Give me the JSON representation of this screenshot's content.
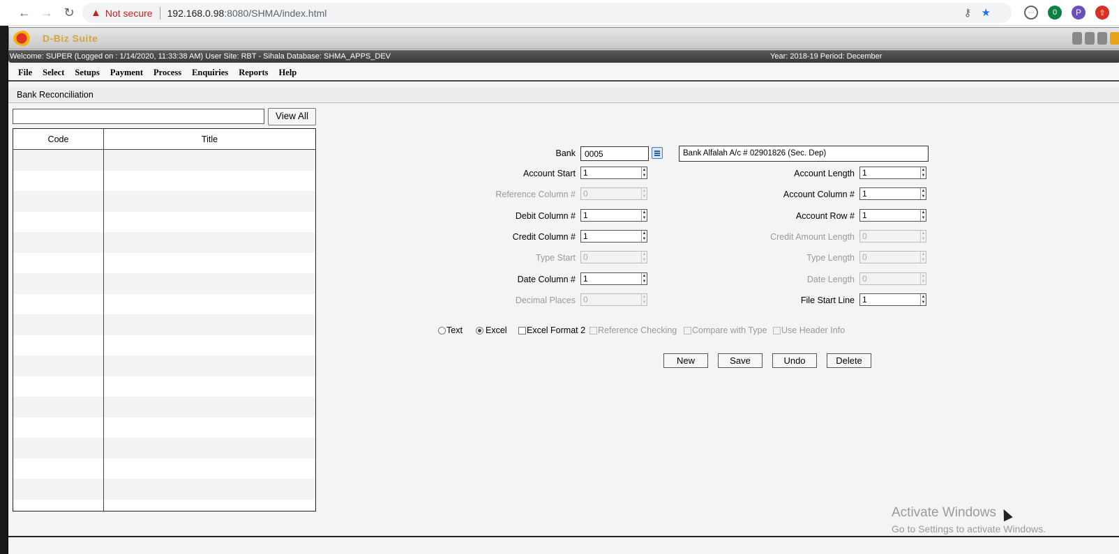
{
  "browser": {
    "not_secure": "Not secure",
    "url_host": "192.168.0.98",
    "url_rest": ":8080/SHMA/index.html",
    "profile_initial": "P",
    "ext_badge": "0"
  },
  "app": {
    "logo_text": "D-Biz Suite",
    "welcome": "Welcome: SUPER (Logged on : 1/14/2020, 11:33:38 AM) User Site: RBT - Sihala Database: SHMA_APPS_DEV",
    "year_period": "Year: 2018-19 Period: December",
    "menu": [
      "File",
      "Select",
      "Setups",
      "Payment",
      "Process",
      "Enquiries",
      "Reports",
      "Help"
    ],
    "page_title": "Bank Reconciliation"
  },
  "list": {
    "search_value": "",
    "view_all_label": "View All",
    "columns": [
      "Code",
      "Title"
    ]
  },
  "form": {
    "bank_label": "Bank",
    "bank_code": "0005",
    "bank_title": "Bank Alfalah A/c # 02901826 (Sec. Dep)",
    "fields_left": [
      {
        "label": "Account Start",
        "value": "1",
        "disabled": false
      },
      {
        "label": "Reference Column #",
        "value": "0",
        "disabled": true
      },
      {
        "label": "Debit Column #",
        "value": "1",
        "disabled": false
      },
      {
        "label": "Credit Column #",
        "value": "1",
        "disabled": false
      },
      {
        "label": "Type Start",
        "value": "0",
        "disabled": true
      },
      {
        "label": "Date Column #",
        "value": "1",
        "disabled": false
      },
      {
        "label": "Decimal Places",
        "value": "0",
        "disabled": true
      }
    ],
    "fields_right": [
      {
        "label": "Account Length",
        "value": "1",
        "disabled": false
      },
      {
        "label": "Account Column #",
        "value": "1",
        "disabled": false
      },
      {
        "label": "Account Row #",
        "value": "1",
        "disabled": false
      },
      {
        "label": "Credit Amount Length",
        "value": "0",
        "disabled": true
      },
      {
        "label": "Type Length",
        "value": "0",
        "disabled": true
      },
      {
        "label": "Date Length",
        "value": "0",
        "disabled": true
      },
      {
        "label": "File Start Line",
        "value": "1",
        "disabled": false
      }
    ],
    "options": {
      "text": "Text",
      "excel": "Excel",
      "excel_format_2": "Excel Format 2",
      "reference_checking": "Reference Checking",
      "compare_with_type": "Compare with Type",
      "use_header_info": "Use Header Info",
      "selected": "excel"
    },
    "buttons": {
      "new": "New",
      "save": "Save",
      "undo": "Undo",
      "delete": "Delete"
    }
  },
  "watermark": {
    "line1": "Activate Windows",
    "line2": "Go to Settings to activate Windows."
  }
}
